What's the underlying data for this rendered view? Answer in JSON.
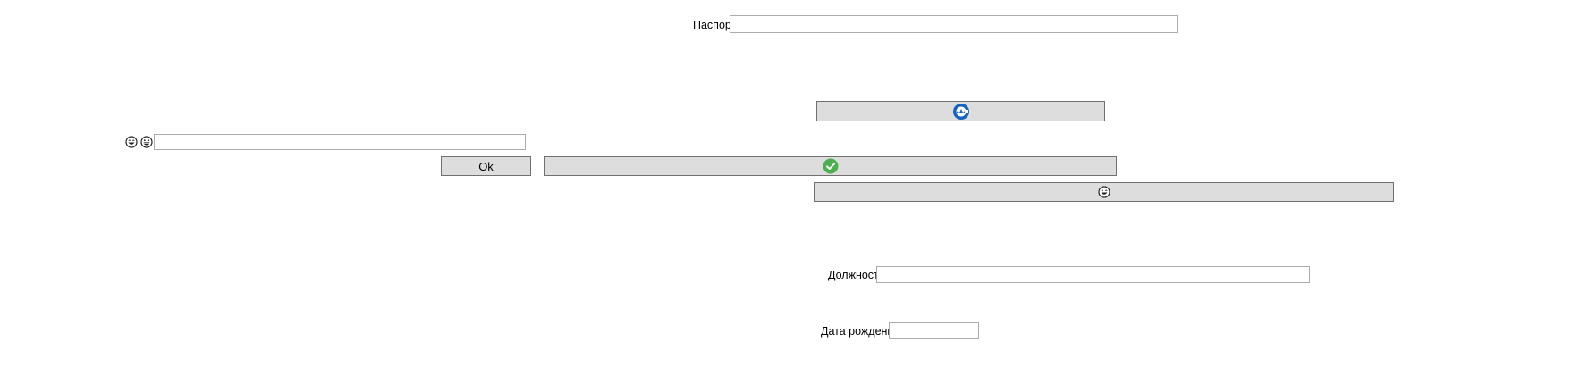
{
  "passport": {
    "label": "Паспорт",
    "value": ""
  },
  "top_icon_button": {
    "icon": "blue-circular-cloud-icon"
  },
  "emoji_field": {
    "icons": [
      "laughing-emoji-icon",
      "grinning-emoji-icon"
    ],
    "value": ""
  },
  "ok_button": {
    "label": "Ok"
  },
  "check_button": {
    "icon": "green-check-icon"
  },
  "emoji_button": {
    "icon": "laughing-emoji-icon"
  },
  "position": {
    "label": "Должность",
    "value": ""
  },
  "birth_date": {
    "label": "Дата рождения",
    "value": ""
  },
  "colors": {
    "button_bg": "#dddddd",
    "button_border": "#707070",
    "field_border": "#ababab",
    "check_green": "#4caf50",
    "icon_blue": "#1565c0"
  }
}
